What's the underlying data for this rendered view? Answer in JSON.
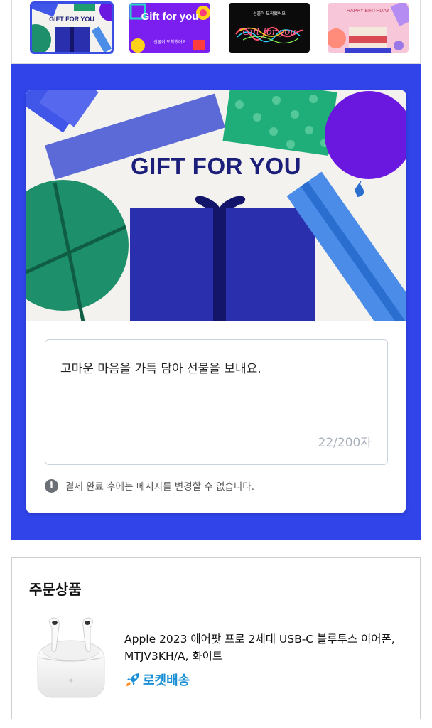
{
  "card_designs": {
    "items": [
      {
        "label": "GIFT FOR YOU",
        "selected": true
      },
      {
        "label": "Gift for you",
        "sublabel": "선물이 도착했어요",
        "selected": false
      },
      {
        "label": "Gift for you",
        "sublabel": "선물이 도착했어요",
        "selected": false
      },
      {
        "label": "HAPPY BIRTHDAY",
        "selected": false
      }
    ]
  },
  "card": {
    "title": "GIFT FOR YOU",
    "message": "고마운 마음을 가득 담아 선물을 보내요.",
    "char_count": "22/200자",
    "notice": "결제 완료 후에는 메시지를 변경할 수 없습니다."
  },
  "order": {
    "title": "주문상품",
    "product_name": "Apple 2023 에어팟 프로 2세대 USB-C 블루투스 이어폰, MTJV3KH/A, 화이트",
    "delivery_badge": "로켓배송"
  },
  "colors": {
    "accent_blue": "#3044ea",
    "rocket_blue": "#1a8fd6",
    "title_navy": "#1c1f7a"
  }
}
